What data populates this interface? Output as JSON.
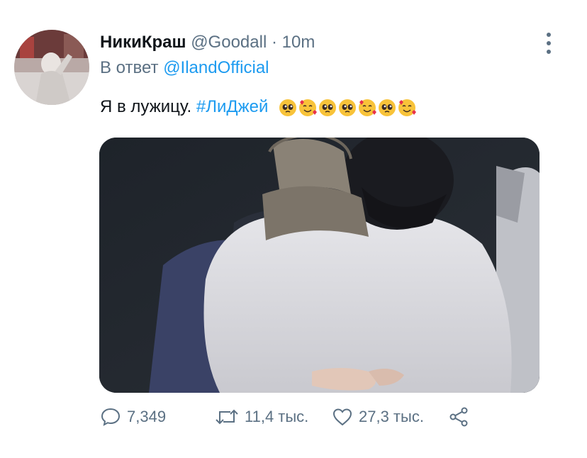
{
  "tweet": {
    "display_name": "НикиКраш",
    "handle": "@Goodall",
    "separator": "·",
    "time": "10m",
    "reply_prefix": "В ответ",
    "reply_to": "@IlandOfficial",
    "text": "Я в лужицу.",
    "hashtag": "#ЛиДжей",
    "emojis": [
      "pleading-face",
      "smiling-face-with-hearts",
      "pleading-face",
      "pleading-face",
      "smiling-face-with-hearts",
      "pleading-face",
      "smiling-face-with-hearts"
    ]
  },
  "actions": {
    "replies": "7,349",
    "retweets": "11,4 тыс.",
    "likes": "27,3 тыс."
  },
  "colors": {
    "link": "#1d9bf0",
    "secondary_text": "#5b7083",
    "primary_text": "#0f1419"
  }
}
